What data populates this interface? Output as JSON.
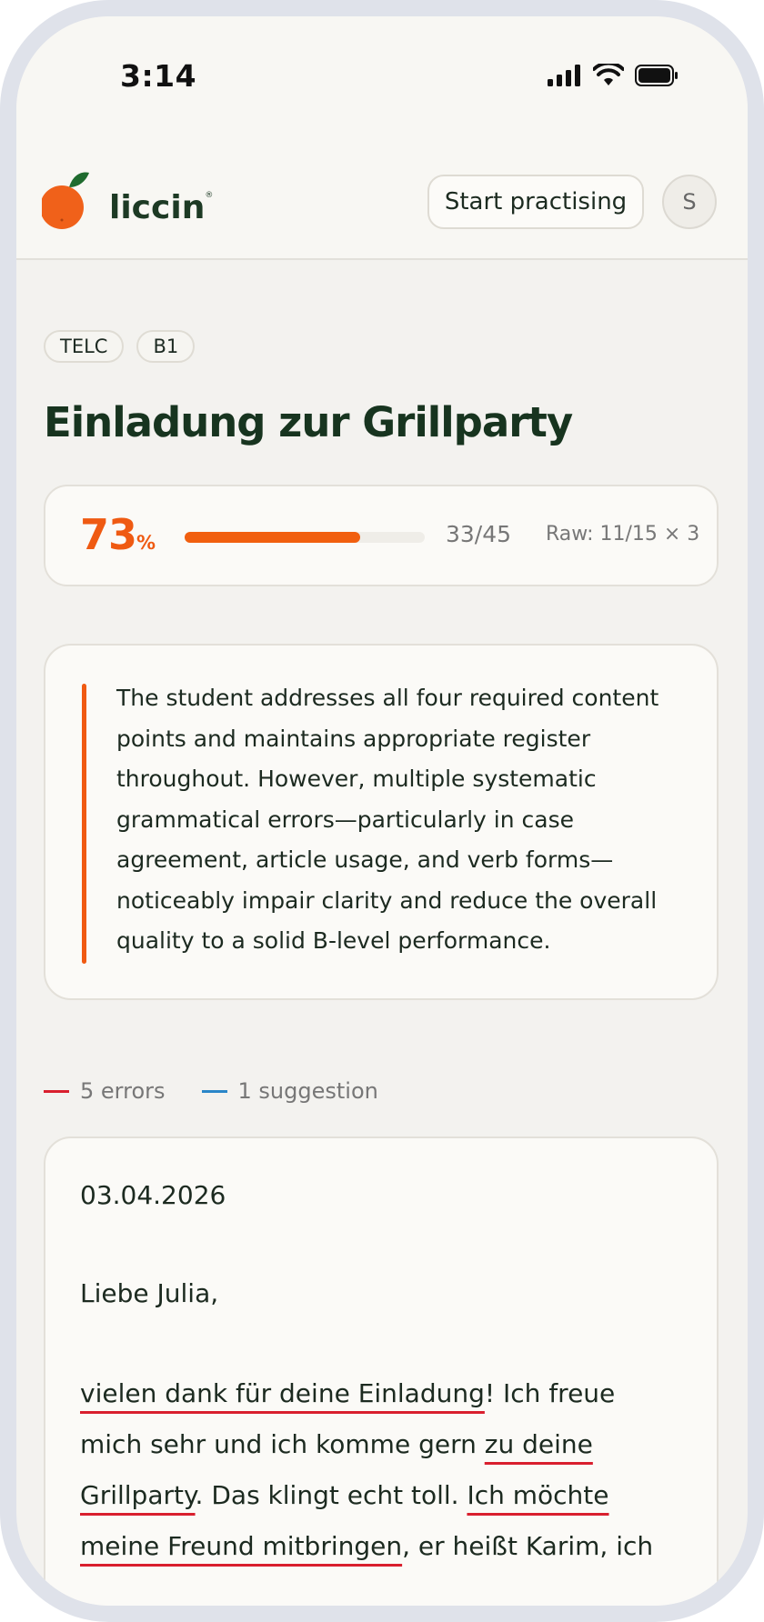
{
  "status": {
    "time": "3:14"
  },
  "header": {
    "brand": "liccin",
    "brand_mark": "®",
    "start_button": "Start practising",
    "avatar_initial": "S"
  },
  "tags": [
    "TELC",
    "B1"
  ],
  "title": "Einladung zur Grillparty",
  "score": {
    "percent": "73",
    "percent_sign": "%",
    "progress": 0.73,
    "fraction": "33/45",
    "raw": "Raw: 11/15 × 3"
  },
  "feedback": "The student addresses all four required content points and maintains appropriate register throughout. However, multiple systematic grammatical errors—particularly in case agreement, article usage, and verb forms—noticeably impair clarity and reduce the overall quality to a solid B-level performance.",
  "legend": {
    "errors": "5 errors",
    "suggestions": "1 suggestion",
    "error_color": "#d91f2e",
    "suggestion_color": "#2a86c8"
  },
  "essay": {
    "date": "03.04.2026",
    "greeting": "Liebe Julia,",
    "line1": {
      "err": "vielen dank für deine Einladung",
      "rest": "! Ich freue"
    },
    "line2": {
      "pre": "mich sehr und ich komme gern ",
      "err": "zu deine"
    },
    "line3": {
      "err1": "Grillparty",
      "mid": ". Das klingt echt toll. ",
      "err2": "Ich möchte"
    },
    "line4": {
      "err": "meine Freund mitbringen",
      "rest": ", er heißt Karim, ich"
    }
  },
  "colors": {
    "accent": "#ef5a12",
    "brand": "#1d3a24",
    "background": "#f3f2ef"
  }
}
